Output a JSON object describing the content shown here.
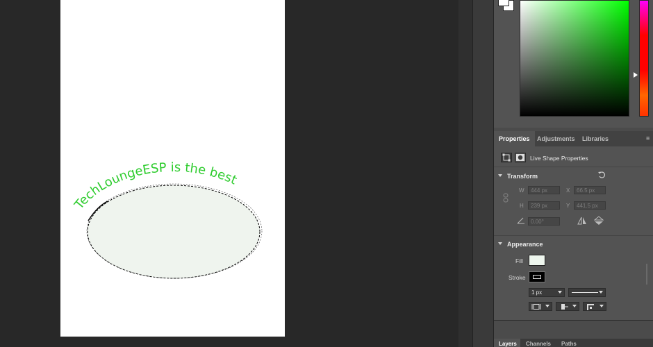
{
  "canvas": {
    "curved_text": "TechLoungeESP is the best",
    "text_color": "#2ecc2e",
    "ellipse_fill": "#eff4ee"
  },
  "color_picker": {
    "foreground": "#ffffff",
    "background": "#ffffff",
    "selected_hue": "#00ff00"
  },
  "properties": {
    "tabs": [
      "Properties",
      "Adjustments",
      "Libraries"
    ],
    "active_tab": "Properties",
    "header_label": "Live Shape Properties",
    "transform": {
      "title": "Transform",
      "w_label": "W",
      "w_value": "444 px",
      "x_label": "X",
      "x_value": "66.5 px",
      "h_label": "H",
      "h_value": "239 px",
      "y_label": "Y",
      "y_value": "441.5 px",
      "angle_value": "0.00°"
    },
    "appearance": {
      "title": "Appearance",
      "fill_label": "Fill",
      "fill_color": "#eef6ee",
      "stroke_label": "Stroke",
      "stroke_color": "#000000",
      "stroke_width": "1 px"
    }
  },
  "bottom_tabs": [
    "Layers",
    "Channels",
    "Paths"
  ],
  "icons": [
    "link-icon",
    "reset-icon",
    "angle-icon",
    "flip-horizontal-icon",
    "flip-vertical-icon",
    "panel-menu-icon",
    "bounding-box-icon",
    "mask-icon",
    "align-icon",
    "caps-icon",
    "corners-icon"
  ]
}
